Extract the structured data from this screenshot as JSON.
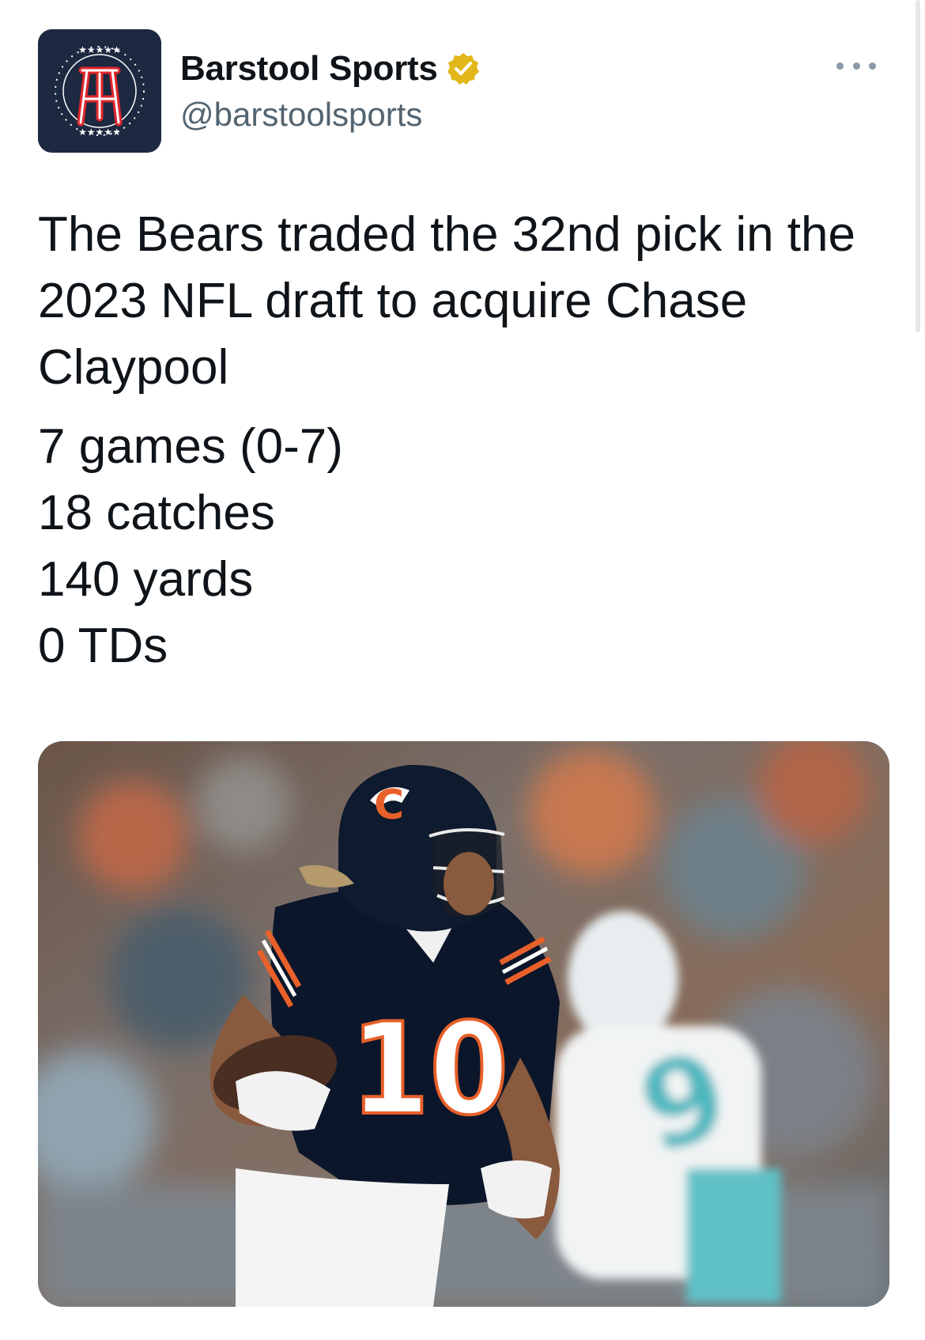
{
  "tweet": {
    "author": {
      "display_name": "Barstool Sports",
      "handle": "@barstoolsports",
      "verified": true,
      "verified_color": "#e2b719",
      "avatar_icon": "barstool-stool-logo-icon",
      "avatar_bg": "#1c2940",
      "avatar_accent": "#e0262d"
    },
    "more_icon": "ellipsis-icon",
    "text_lead": "The Bears traded the 32nd pick in the 2023 NFL draft to acquire Chase Claypool",
    "stats": [
      "7 games (0-7)",
      "18 catches",
      "140 yards",
      "0 TDs"
    ],
    "media": {
      "kind": "photo",
      "jersey_number": "10",
      "jersey_color": "#0b162a",
      "stripe_color": "#e8602a"
    }
  }
}
